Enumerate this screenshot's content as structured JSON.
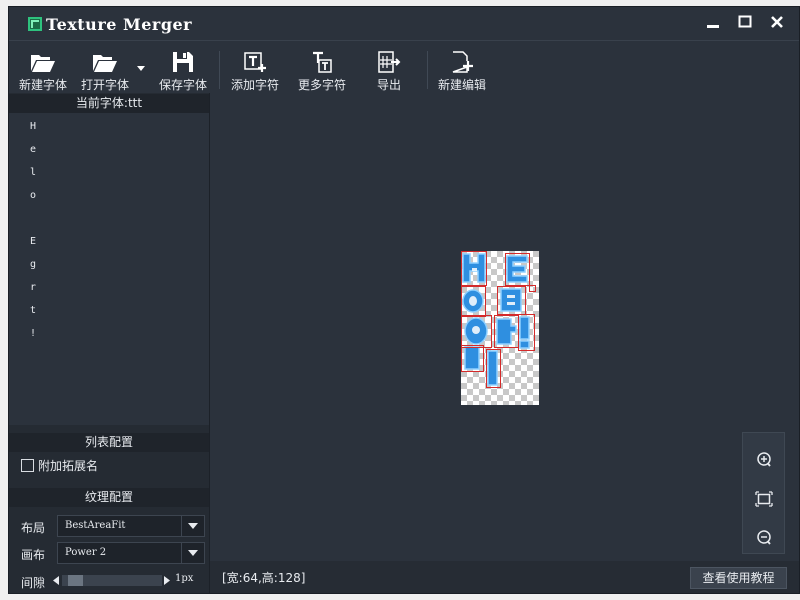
{
  "window": {
    "title": "Texture Merger"
  },
  "toolbar": {
    "new_font": "新建字体",
    "open_font": "打开字体",
    "save_font": "保存字体",
    "add_char": "添加字符",
    "more_chars": "更多字符",
    "export": "导出",
    "new_edit": "新建编辑"
  },
  "current_font": {
    "header": "当前字体:ttt",
    "glyphs": [
      "H",
      "e",
      "l",
      "o",
      "",
      "E",
      "g",
      "r",
      "t",
      "!"
    ]
  },
  "list_config": {
    "header": "列表配置",
    "append_ext_label": "附加拓展名",
    "append_ext_checked": false
  },
  "texture_config": {
    "header": "纹理配置",
    "layout_label": "布局",
    "layout_value": "BestAreaFit",
    "canvas_label": "画布",
    "canvas_value": "Power 2",
    "gap_label": "间隙",
    "gap_value": "1px",
    "gap_slider_fraction": 0.0
  },
  "status": {
    "size_text": "[宽:64,高:128]",
    "tutorial_button": "查看使用教程"
  },
  "colors": {
    "window_bg": "#2b323c",
    "panel_bg": "#252b33",
    "accent_blue": "#2f8fe0",
    "bbox_red": "#d42a2a",
    "logo_green": "#2ec27e"
  },
  "icons": [
    "folder-new-icon",
    "folder-open-icon",
    "save-icon",
    "add-text-icon",
    "more-text-icon",
    "export-icon",
    "new-edit-icon",
    "zoom-in-icon",
    "fit-icon",
    "zoom-out-icon",
    "minimize-icon",
    "maximize-icon",
    "close-icon"
  ]
}
